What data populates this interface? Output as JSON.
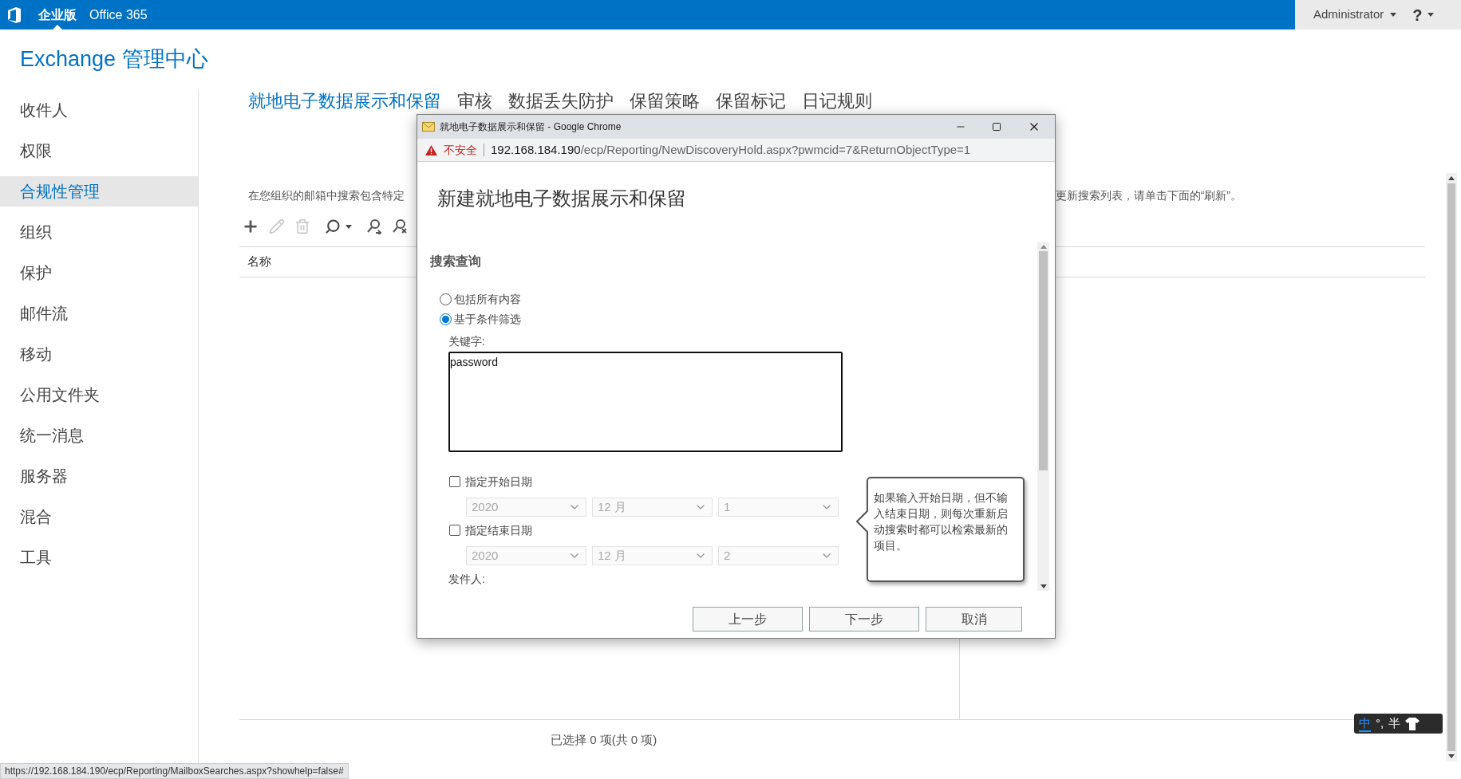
{
  "top_bar": {
    "items": [
      {
        "label": "企业版",
        "selected": true
      },
      {
        "label": "Office 365",
        "selected": false
      }
    ],
    "user": "Administrator",
    "help": "?"
  },
  "app_title": "Exchange 管理中心",
  "sidebar": {
    "items": [
      {
        "label": "收件人",
        "selected": false
      },
      {
        "label": "权限",
        "selected": false
      },
      {
        "label": "合规性管理",
        "selected": true
      },
      {
        "label": "组织",
        "selected": false
      },
      {
        "label": "保护",
        "selected": false
      },
      {
        "label": "邮件流",
        "selected": false
      },
      {
        "label": "移动",
        "selected": false
      },
      {
        "label": "公用文件夹",
        "selected": false
      },
      {
        "label": "统一消息",
        "selected": false
      },
      {
        "label": "服务器",
        "selected": false
      },
      {
        "label": "混合",
        "selected": false
      },
      {
        "label": "工具",
        "selected": false
      }
    ]
  },
  "tabs": [
    {
      "label": "就地电子数据展示和保留",
      "selected": true
    },
    {
      "label": "审核",
      "selected": false
    },
    {
      "label": "数据丢失防护",
      "selected": false
    },
    {
      "label": "保留策略",
      "selected": false
    },
    {
      "label": "保留标记",
      "selected": false
    },
    {
      "label": "日记规则",
      "selected": false
    }
  ],
  "description": {
    "left": "在您组织的邮箱中搜索包含特定",
    "right": "更新搜索列表，请单击下面的“刷新”。"
  },
  "table": {
    "columns": [
      "名称"
    ]
  },
  "footer": "已选择 0 项(共 0 项)",
  "status_url": "https://192.168.184.190/ecp/Reporting/MailboxSearches.aspx?showhelp=false#",
  "ime": {
    "mode": "中",
    "punct": "°,",
    "width": "半"
  },
  "dialog": {
    "window_title": "就地电子数据展示和保留 - Google Chrome",
    "security": "不安全",
    "url_host": "192.168.184.190",
    "url_path": "/ecp/Reporting/NewDiscoveryHold.aspx?pwmcid=7&ReturnObjectType=1",
    "heading": "新建就地电子数据展示和保留",
    "section": "搜索查询",
    "radios": [
      {
        "label": "包括所有内容",
        "selected": false
      },
      {
        "label": "基于条件筛选",
        "selected": true
      }
    ],
    "keywords": {
      "label": "关键字:",
      "value": "password"
    },
    "date_ranges": [
      {
        "label": "指定开始日期",
        "checked": false,
        "year": "2020",
        "month": "12 月",
        "day": "1"
      },
      {
        "label": "指定结束日期",
        "checked": false,
        "year": "2020",
        "month": "12 月",
        "day": "2"
      }
    ],
    "sender_label": "发件人:",
    "tooltip": "如果输入开始日期，但不输入结束日期，则每次重新启动搜索时都可以检索最新的项目。",
    "buttons": [
      "上一步",
      "下一步",
      "取消"
    ]
  }
}
